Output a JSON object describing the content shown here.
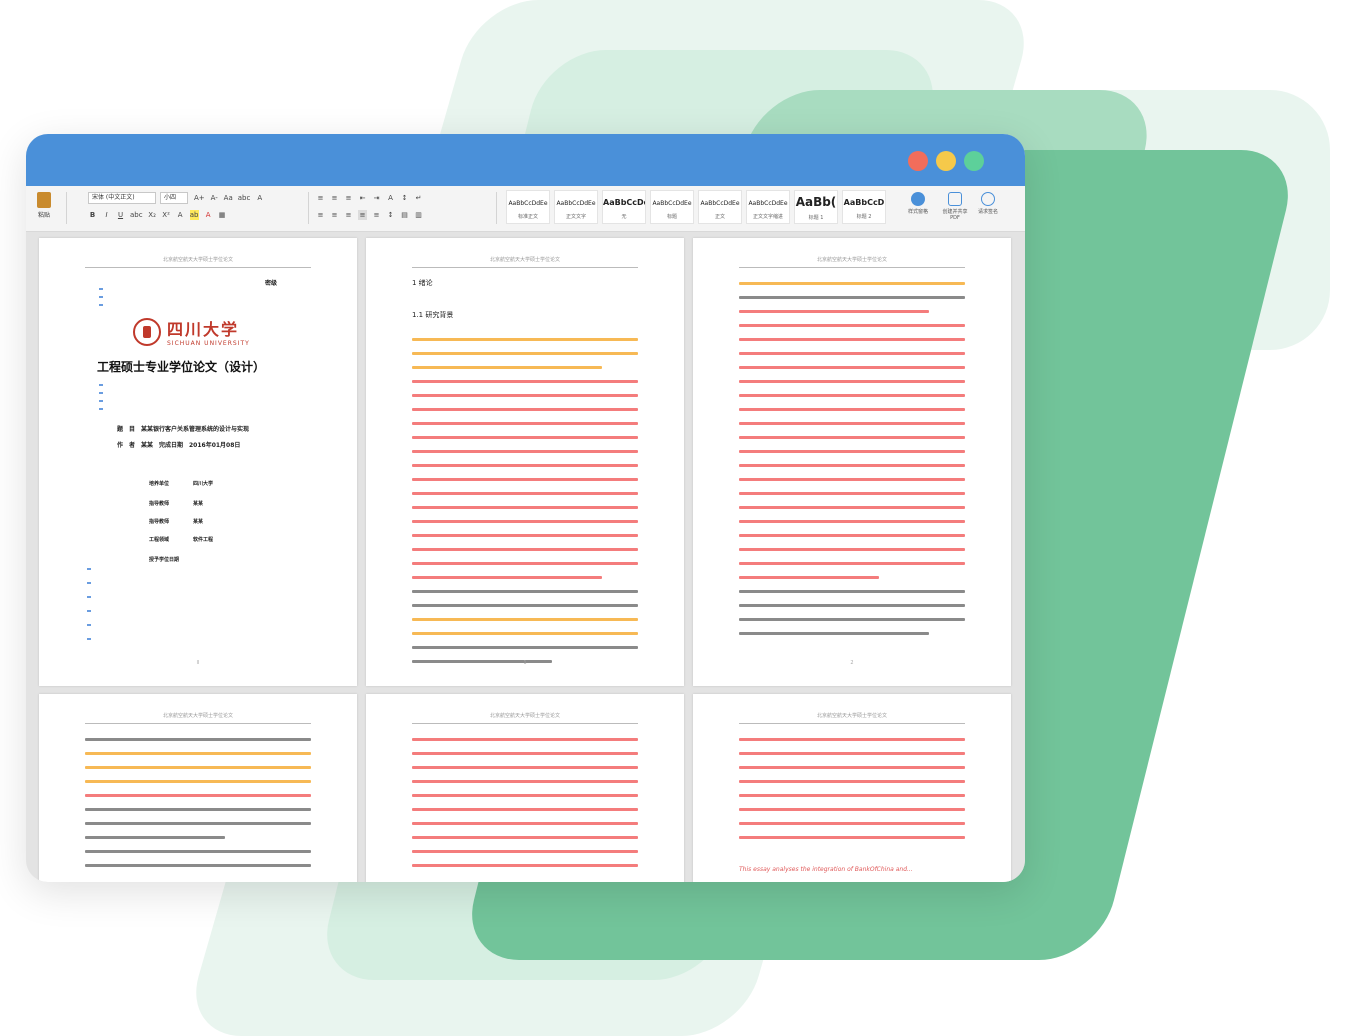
{
  "window": {
    "controls": [
      "close",
      "minimize",
      "maximize"
    ],
    "colors": {
      "titlebar": "#4a90d9",
      "close": "#f26d5b",
      "minimize": "#f6c94a",
      "maximize": "#5dd09a"
    }
  },
  "ribbon": {
    "paste_label": "粘贴",
    "font_name": "宋体 (中文正文)",
    "font_size": "小四",
    "toolbar_row1": [
      "A+",
      "A-",
      "Aa",
      "abc",
      "A",
      "≡",
      "≡",
      "≡",
      "⇤",
      "⇥",
      "A",
      "↕",
      "↵"
    ],
    "toolbar_row2": [
      "B",
      "I",
      "U",
      "abc",
      "X₂",
      "X²",
      "A",
      "ab",
      "A",
      "▦",
      "≡",
      "≡",
      "≡",
      "≡",
      "≡",
      "↕",
      "▤",
      "▥"
    ],
    "styles": [
      {
        "sample": "AaBbCcDdEe",
        "name": "标准正文",
        "variant": "small"
      },
      {
        "sample": "AaBbCcDdEe",
        "name": "正文文字",
        "variant": "small"
      },
      {
        "sample": "AaBbCcDd",
        "name": "无",
        "variant": "small"
      },
      {
        "sample": "AaBbCcDdEe",
        "name": "标题",
        "variant": "small"
      },
      {
        "sample": "AaBbCcDdEe",
        "name": "正文",
        "variant": "small"
      },
      {
        "sample": "AaBbCcDdEe",
        "name": "正文文字缩进",
        "variant": "small"
      },
      {
        "sample": "AaBb(",
        "name": "标题 1",
        "variant": "big"
      },
      {
        "sample": "AaBbCcD",
        "name": "标题 2",
        "variant": "mid"
      }
    ],
    "right_buttons": [
      {
        "label": "样式窗格",
        "icon": "styles-pane-icon"
      },
      {
        "label": "创建并共享 PDF",
        "icon": "pdf-share-icon"
      },
      {
        "label": "请求签名",
        "icon": "signature-icon"
      }
    ]
  },
  "pages": {
    "cover": {
      "header": "北京航空航天大学硕士学位论文",
      "corner": "密级",
      "logo_text": "四川大学",
      "logo_sub": "SICHUAN UNIVERSITY",
      "title": "工程硕士专业学位论文（设计）",
      "topic": "题　目　某某银行客户关系管理系统的设计与实现",
      "author": "作　者　某某　完成日期　2016年01月08日",
      "info": [
        {
          "k": "培养单位",
          "v": "四川大学"
        },
        {
          "k": "指导教师",
          "v": "某某"
        },
        {
          "k": "指导教师",
          "v": "某某"
        },
        {
          "k": "工程领域",
          "v": "软件工程"
        },
        {
          "k": "授予学位日期",
          "v": ""
        }
      ],
      "page_no": "II"
    },
    "p2": {
      "header": "北京航空航天大学硕士学位论文",
      "h1": "1 绪论",
      "h2": "1.1 研究背景",
      "page_no": "1"
    },
    "p3": {
      "header": "北京航空航天大学硕士学位论文",
      "page_no": "2"
    },
    "p4": {
      "header": "北京航空航天大学硕士学位论文"
    },
    "p5": {
      "header": "北京航空航天大学硕士学位论文"
    },
    "p6": {
      "header": "北京航空航天大学硕士学位论文",
      "eng": "This essay analyses the integration of BankOfChina and..."
    }
  }
}
